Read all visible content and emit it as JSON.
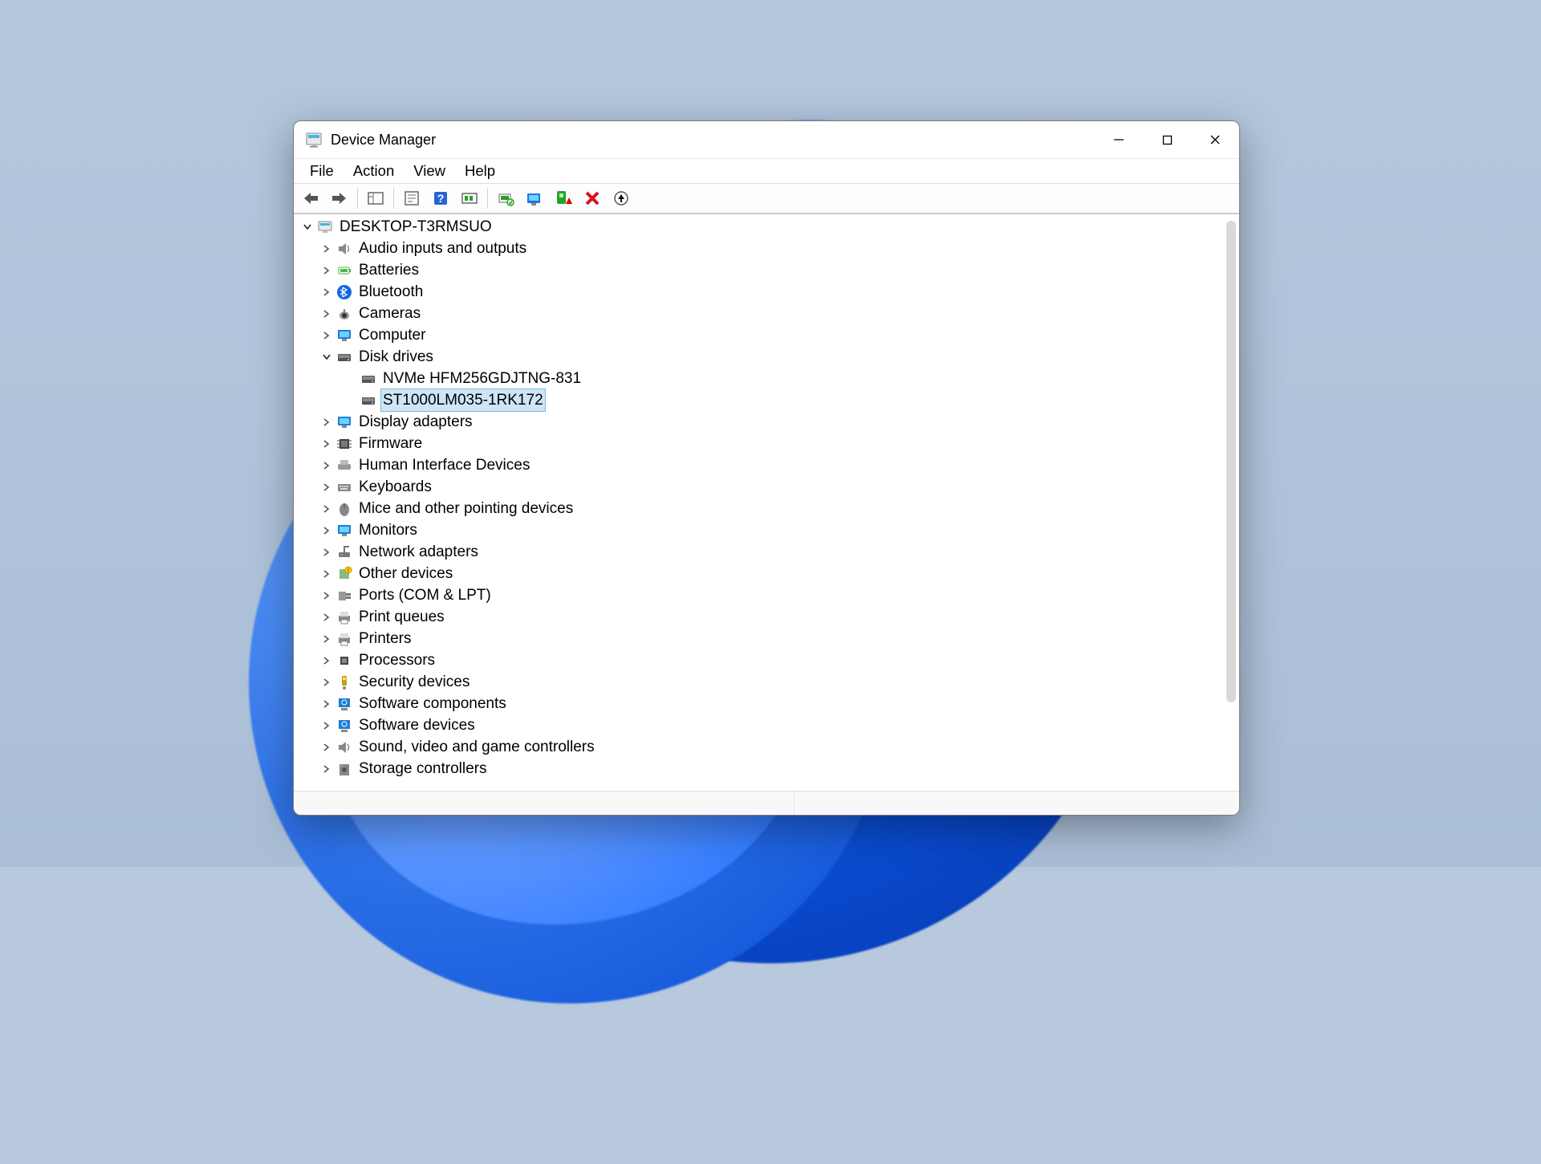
{
  "window": {
    "title": "Device Manager"
  },
  "menu": {
    "items": [
      "File",
      "Action",
      "View",
      "Help"
    ]
  },
  "tree": {
    "root": "DESKTOP-T3RMSUO",
    "disk_children": [
      "NVMe HFM256GDJTNG-831",
      "ST1000LM035-1RK172"
    ],
    "cats": [
      "Audio inputs and outputs",
      "Batteries",
      "Bluetooth",
      "Cameras",
      "Computer",
      "Disk drives",
      "Display adapters",
      "Firmware",
      "Human Interface Devices",
      "Keyboards",
      "Mice and other pointing devices",
      "Monitors",
      "Network adapters",
      "Other devices",
      "Ports (COM & LPT)",
      "Print queues",
      "Printers",
      "Processors",
      "Security devices",
      "Software components",
      "Software devices",
      "Sound, video and game controllers",
      "Storage controllers"
    ]
  }
}
